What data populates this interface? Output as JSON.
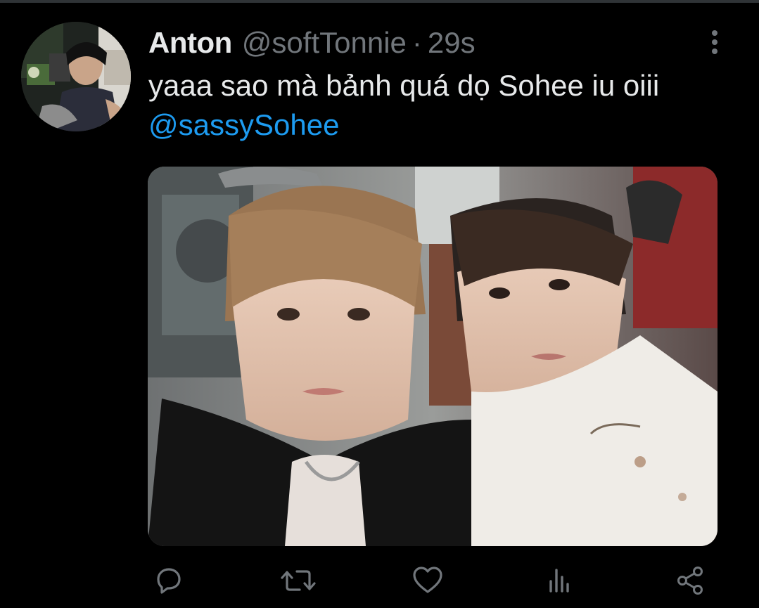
{
  "tweet": {
    "display_name": "Anton",
    "handle": "@softTonnie",
    "separator": "·",
    "time": "29s",
    "text": "yaaa sao mà bảnh quá dọ Sohee iu oiii",
    "mention": "@sassySohee"
  },
  "icons": {
    "more": "more-vertical-icon",
    "reply": "reply-icon",
    "retweet": "retweet-icon",
    "like": "heart-icon",
    "views": "analytics-icon",
    "share": "share-icon"
  },
  "colors": {
    "background": "#000000",
    "text": "#e7e9ea",
    "muted": "#71767b",
    "link": "#1d9bf0"
  }
}
